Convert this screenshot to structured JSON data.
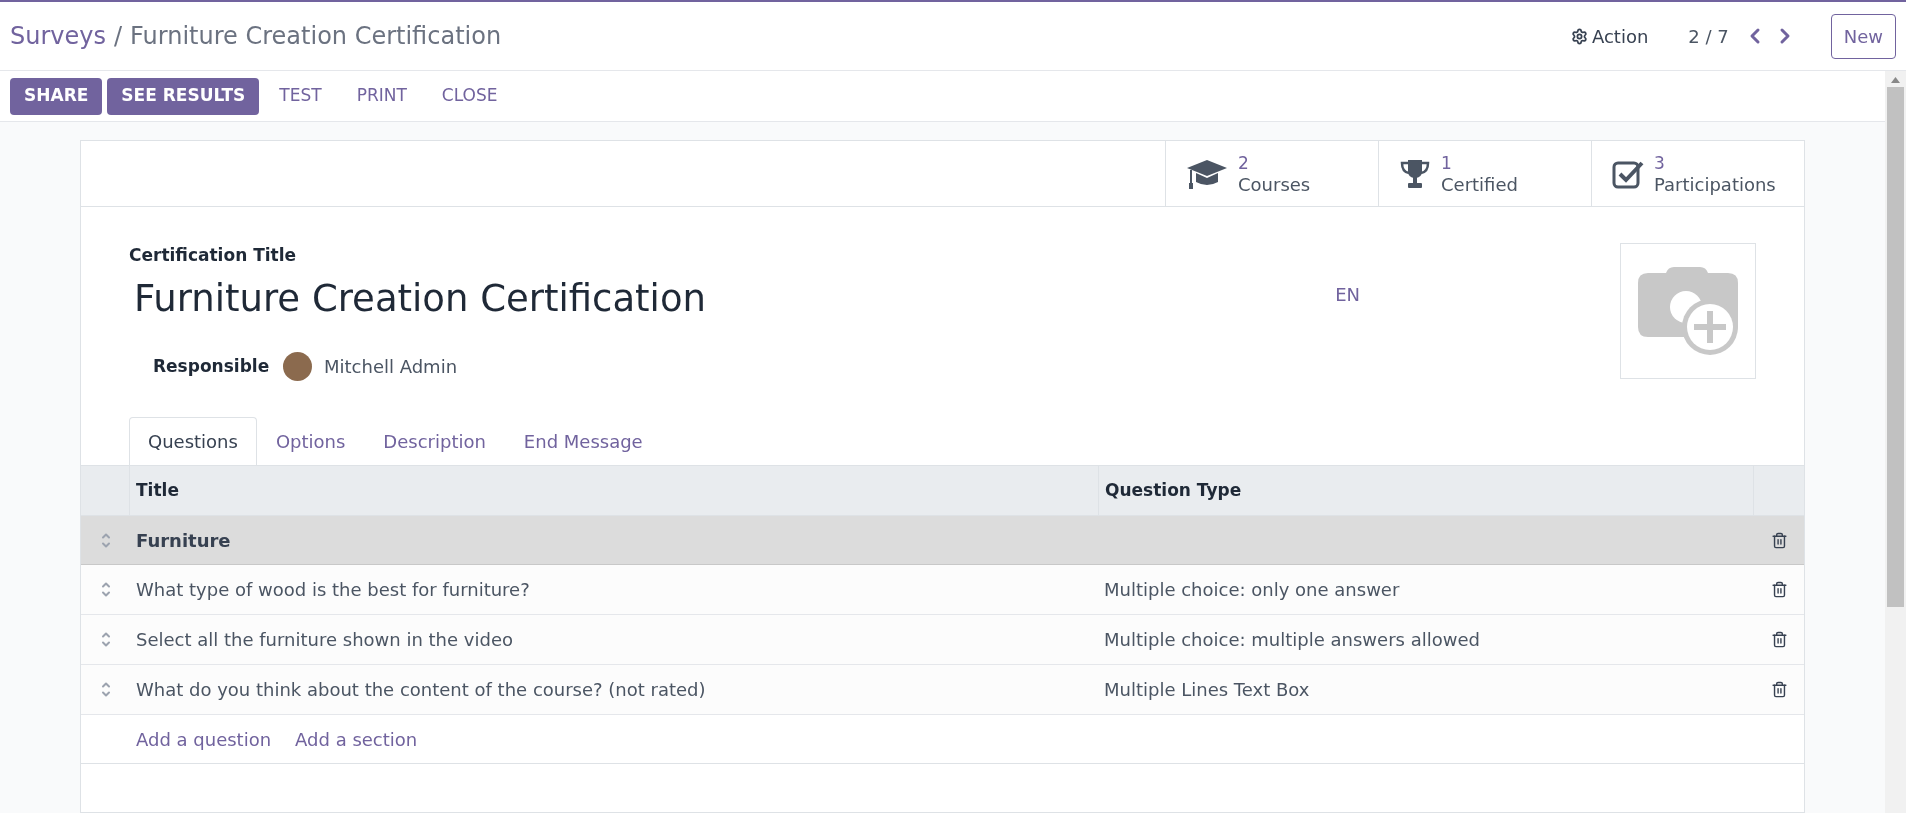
{
  "breadcrumb": {
    "parent": "Surveys",
    "separator": "/",
    "current": "Furniture Creation Certification"
  },
  "control_panel": {
    "action": "Action",
    "pager": "2 / 7",
    "new_button": "New"
  },
  "toolbar": [
    {
      "label": "SHARE",
      "kind": "primary"
    },
    {
      "label": "SEE RESULTS",
      "kind": "primary"
    },
    {
      "label": "TEST",
      "kind": "link"
    },
    {
      "label": "PRINT",
      "kind": "link"
    },
    {
      "label": "CLOSE",
      "kind": "link"
    }
  ],
  "stat_buttons": [
    {
      "kind": "courses",
      "count": "2",
      "label": "Courses"
    },
    {
      "kind": "certified",
      "count": "1",
      "label": "Certified"
    },
    {
      "kind": "participations",
      "count": "3",
      "label": "Participations"
    }
  ],
  "form": {
    "title_label": "Certification Title",
    "title": "Furniture Creation Certification",
    "language": "EN",
    "responsible_label": "Responsible",
    "responsible": "Mitchell Admin"
  },
  "tabs": [
    {
      "label": "Questions",
      "selected": true
    },
    {
      "label": "Options",
      "selected": false
    },
    {
      "label": "Description",
      "selected": false
    },
    {
      "label": "End Message",
      "selected": false
    }
  ],
  "table": {
    "columns": [
      "Title",
      "Question Type"
    ],
    "rows": [
      {
        "kind": "section",
        "title": "Furniture"
      },
      {
        "kind": "question",
        "title": "What type of wood is the best for furniture?",
        "question_type": "Multiple choice: only one answer"
      },
      {
        "kind": "question",
        "title": "Select all the furniture shown in the video",
        "question_type": "Multiple choice: multiple answers allowed"
      },
      {
        "kind": "question",
        "title": "What do you think about the content of the course? (not rated)",
        "question_type": "Multiple Lines Text Box"
      }
    ],
    "add_links": [
      "Add a question",
      "Add a section"
    ]
  }
}
